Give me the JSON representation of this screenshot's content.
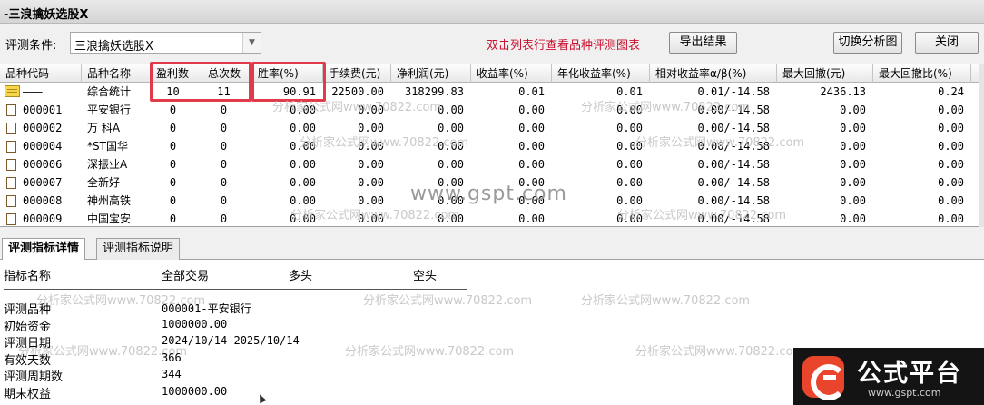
{
  "window": {
    "title": "-三浪擒妖选股X"
  },
  "criteria": {
    "label": "评测条件:",
    "value": "三浪擒妖选股X"
  },
  "hint": "双击列表行查看品种评测图表",
  "buttons": {
    "export": "导出结果",
    "switch": "切换分析图",
    "close": "关闭"
  },
  "table": {
    "columns": [
      "品种代码",
      "品种名称",
      "盈利数",
      "总次数",
      "胜率(%)",
      "手续费(元)",
      "净利润(元)",
      "收益率(%)",
      "年化收益率(%)",
      "相对收益率α/β(%)",
      "最大回撤(元)",
      "最大回撤比(%)"
    ],
    "rows": [
      {
        "code": "———",
        "name": "综合统计",
        "win": "10",
        "total": "11",
        "rate": "90.91",
        "fee": "22500.00",
        "profit": "318299.83",
        "ret": "0.01",
        "annual": "0.01",
        "rel": "0.01/-14.58",
        "dd": "2436.13",
        "ddr": "0.24"
      },
      {
        "code": "000001",
        "name": "平安银行",
        "win": "0",
        "total": "0",
        "rate": "0.00",
        "fee": "0.00",
        "profit": "0.00",
        "ret": "0.00",
        "annual": "0.00",
        "rel": "0.00/-14.58",
        "dd": "0.00",
        "ddr": "0.00"
      },
      {
        "code": "000002",
        "name": "万 科A",
        "win": "0",
        "total": "0",
        "rate": "0.00",
        "fee": "0.00",
        "profit": "0.00",
        "ret": "0.00",
        "annual": "0.00",
        "rel": "0.00/-14.58",
        "dd": "0.00",
        "ddr": "0.00"
      },
      {
        "code": "000004",
        "name": "*ST国华",
        "win": "0",
        "total": "0",
        "rate": "0.00",
        "fee": "0.00",
        "profit": "0.00",
        "ret": "0.00",
        "annual": "0.00",
        "rel": "0.00/-14.58",
        "dd": "0.00",
        "ddr": "0.00"
      },
      {
        "code": "000006",
        "name": "深振业A",
        "win": "0",
        "total": "0",
        "rate": "0.00",
        "fee": "0.00",
        "profit": "0.00",
        "ret": "0.00",
        "annual": "0.00",
        "rel": "0.00/-14.58",
        "dd": "0.00",
        "ddr": "0.00"
      },
      {
        "code": "000007",
        "name": "全新好",
        "win": "0",
        "total": "0",
        "rate": "0.00",
        "fee": "0.00",
        "profit": "0.00",
        "ret": "0.00",
        "annual": "0.00",
        "rel": "0.00/-14.58",
        "dd": "0.00",
        "ddr": "0.00"
      },
      {
        "code": "000008",
        "name": "神州高铁",
        "win": "0",
        "total": "0",
        "rate": "0.00",
        "fee": "0.00",
        "profit": "0.00",
        "ret": "0.00",
        "annual": "0.00",
        "rel": "0.00/-14.58",
        "dd": "0.00",
        "ddr": "0.00"
      },
      {
        "code": "000009",
        "name": "中国宝安",
        "win": "0",
        "total": "0",
        "rate": "0.00",
        "fee": "0.00",
        "profit": "0.00",
        "ret": "0.00",
        "annual": "0.00",
        "rel": "0.00/-14.58",
        "dd": "0.00",
        "ddr": "0.00"
      }
    ]
  },
  "tabs": [
    "评测指标详情",
    "评测指标说明"
  ],
  "detail": {
    "headers": [
      "指标名称",
      "全部交易",
      "多头",
      "空头"
    ],
    "items": [
      {
        "label": "评测品种",
        "value": "000001-平安银行"
      },
      {
        "label": "初始资金",
        "value": "1000000.00"
      },
      {
        "label": "评测日期",
        "value": "2024/10/14-2025/10/14"
      },
      {
        "label": "有效天数",
        "value": "366"
      },
      {
        "label": "评测周期数",
        "value": "344"
      },
      {
        "label": "期末权益",
        "value": "1000000.00"
      }
    ]
  },
  "watermark": {
    "site": "www.gspt.com",
    "text": "分析家公式网www.70822.com"
  },
  "logo": {
    "name": "公式平台",
    "url": "www.gspt.com"
  },
  "colors": {
    "highlight": "#e03a4b",
    "hint": "#c8102e",
    "logo_accent": "#e8452c"
  },
  "icons": {
    "summary": "folder-icon",
    "stock": "document-icon"
  }
}
